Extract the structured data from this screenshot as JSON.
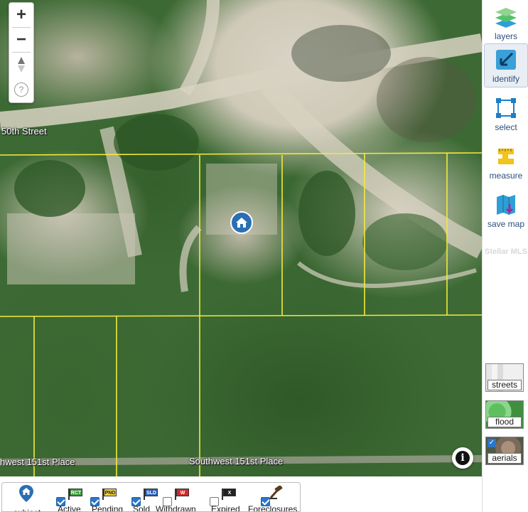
{
  "map": {
    "streets": {
      "top": "50th Street",
      "bottom_left": "hwest 151st Place",
      "bottom_center": "Southwest 151st Place"
    }
  },
  "zoom": {
    "zoom_in": "+",
    "zoom_out": "−",
    "help": "?"
  },
  "toolbar": {
    "layers": "layers",
    "identify": "identify",
    "select": "select",
    "measure": "measure",
    "save_map": "save map",
    "watermark": "Stellar MLS"
  },
  "layer_toggles": {
    "streets": "streets",
    "flood": "flood",
    "aerials": "aerials"
  },
  "info": "i",
  "legend": {
    "subject": "subject",
    "items": [
      {
        "label": "Active",
        "badge": "RCT",
        "checked": true,
        "color": "#3a9a3a",
        "text_color": "#ffffff"
      },
      {
        "label": "Pending",
        "badge": "PND",
        "checked": true,
        "color": "#f2d23a",
        "text_color": "#222222"
      },
      {
        "label": "Sold",
        "badge": "SLD",
        "checked": true,
        "color": "#2b5fb8",
        "text_color": "#ffffff"
      },
      {
        "label": "Withdrawn",
        "badge": "W",
        "checked": false,
        "color": "#d12a2a",
        "text_color": "#ffffff"
      },
      {
        "label": "Expired",
        "badge": "X",
        "checked": false,
        "color": "#222222",
        "text_color": "#ffffff"
      }
    ],
    "foreclosures": "Foreclosures"
  }
}
